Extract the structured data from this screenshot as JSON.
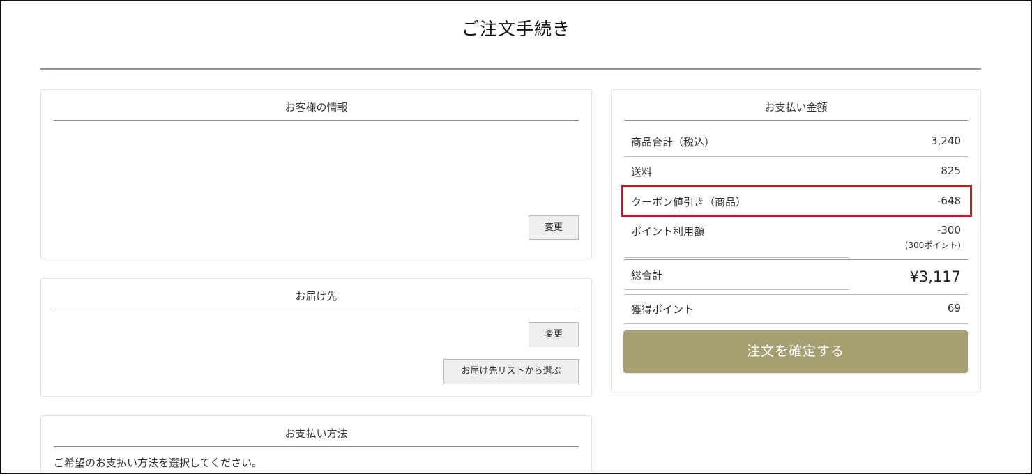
{
  "page": {
    "title": "ご注文手続き"
  },
  "customer": {
    "heading": "お客様の情報",
    "change_label": "変更"
  },
  "delivery": {
    "heading": "お届け先",
    "change_label": "変更",
    "list_label": "お届け先リストから選ぶ"
  },
  "payment_method": {
    "heading": "お支払い方法",
    "instruction": "ご希望のお支払い方法を選択してください。"
  },
  "payment_amount": {
    "heading": "お支払い金額",
    "rows": [
      {
        "label": "商品合計（税込）",
        "value": "3,240"
      },
      {
        "label": "送料",
        "value": "825"
      },
      {
        "label": "クーポン値引き（商品）",
        "value": "-648"
      },
      {
        "label": "ポイント利用額",
        "value": "-300",
        "note": "(300ポイント)"
      }
    ],
    "total": {
      "label": "総合計",
      "value": "¥3,117"
    },
    "earned": {
      "label": "獲得ポイント",
      "value": "69"
    },
    "confirm_label": "注文を確定する"
  },
  "colors": {
    "confirm_button": "#a69f72",
    "highlight": "#d60f16",
    "title_rule": "#8795a1"
  }
}
